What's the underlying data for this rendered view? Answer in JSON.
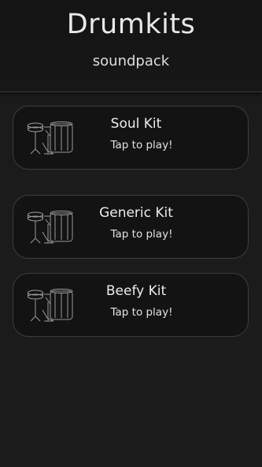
{
  "header": {
    "title": "Drumkits",
    "subtitle": "soundpack"
  },
  "kits": [
    {
      "name": "Soul Kit",
      "hint": "Tap to play!",
      "icon": "drum-kit-icon"
    },
    {
      "name": "Generic Kit",
      "hint": "Tap to play!",
      "icon": "drum-kit-icon"
    },
    {
      "name": "Beefy Kit",
      "hint": "Tap to play!",
      "icon": "drum-kit-icon"
    }
  ],
  "colors": {
    "background": "#1b1b1c",
    "card_background": "#131314",
    "card_border": "#3d3d3e",
    "text": "#ececec"
  }
}
